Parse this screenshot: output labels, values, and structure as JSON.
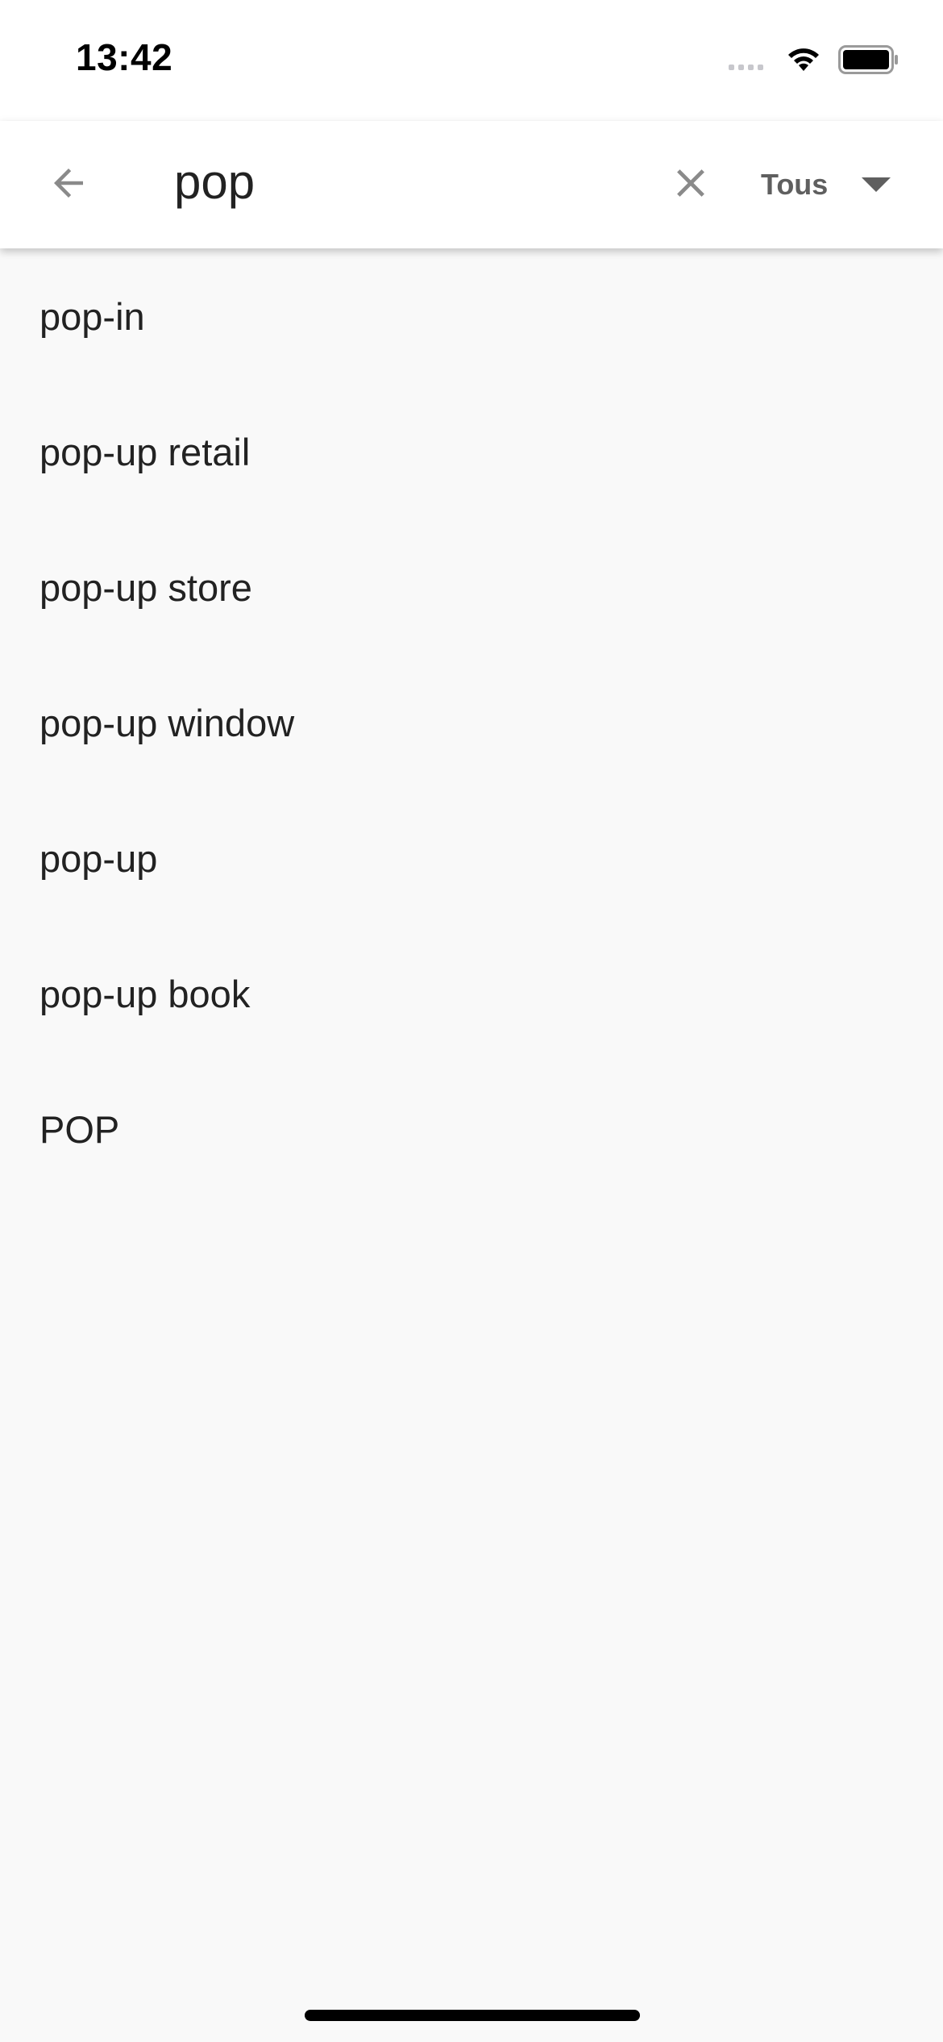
{
  "status_bar": {
    "time": "13:42",
    "signal_icon": "cellular-signal-icon",
    "wifi_icon": "wifi-icon",
    "battery_icon": "battery-icon"
  },
  "search_bar": {
    "back_icon": "arrow-left-icon",
    "query": "pop",
    "clear_icon": "close-icon",
    "filter": {
      "selected": "Tous",
      "caret_icon": "caret-down-icon"
    }
  },
  "results": [
    {
      "label": "pop-in"
    },
    {
      "label": "pop-up retail"
    },
    {
      "label": "pop-up store"
    },
    {
      "label": "pop-up window"
    },
    {
      "label": "pop-up"
    },
    {
      "label": "pop-up book"
    },
    {
      "label": "POP"
    }
  ],
  "colors": {
    "background": "#f9f9f9",
    "app_bar": "#ffffff",
    "text": "#222222",
    "icon_gray": "#8a8a8a"
  }
}
